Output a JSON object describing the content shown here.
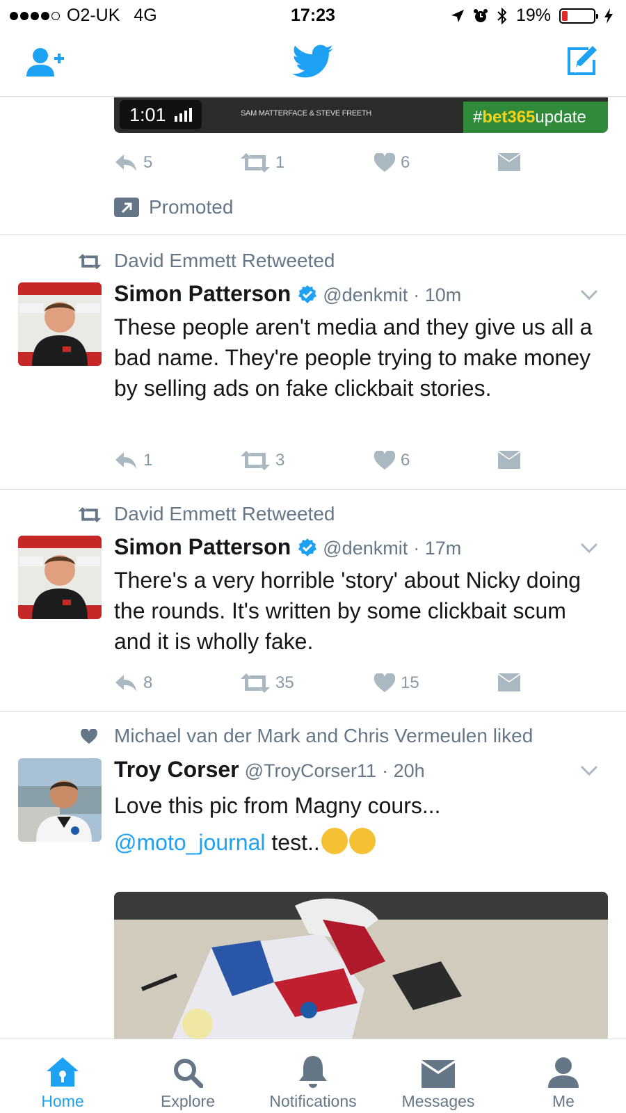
{
  "status_bar": {
    "carrier": "O2-UK",
    "network": "4G",
    "time": "17:23",
    "battery": "19%",
    "battery_level": 0.19,
    "signal_bars": 4
  },
  "nav": {
    "left_icon": "add-user-icon",
    "center_icon": "twitter-bird-icon",
    "right_icon": "compose-icon"
  },
  "colors": {
    "accent": "#1da1f2",
    "secondary_text": "#657786",
    "action_gray": "#8899a6",
    "battery_low": "#e02a2a"
  },
  "promo_tweet": {
    "video_duration": "1:01",
    "video_caption": "SAM MATTERFACE & STEVE FREETH",
    "video_tag_hash": "#",
    "video_tag_bold": "bet365",
    "video_tag_rest": "update",
    "replies": "5",
    "retweets": "1",
    "likes": "6",
    "promoted_label": "Promoted"
  },
  "tweets": [
    {
      "context": "David Emmett Retweeted",
      "name": "Simon Patterson",
      "handle": "@denkmit",
      "time": "· 10m",
      "text": "These people aren't media and they give us all a bad name. They're people trying to make money by selling ads on fake clickbait stories.",
      "replies": "1",
      "retweets": "3",
      "likes": "6"
    },
    {
      "context": "David Emmett Retweeted",
      "name": "Simon Patterson",
      "handle": "@denkmit",
      "time": "· 17m",
      "text": "There's a very horrible 'story' about Nicky doing the rounds. It's written by some clickbait scum  and it is wholly fake.",
      "replies": "8",
      "retweets": "35",
      "likes": "15"
    },
    {
      "context": "Michael van der Mark and Chris Vermeulen liked",
      "name": "Troy Corser",
      "handle": "@TroyCorser11",
      "time": "· 20h",
      "text": "Love this pic from Magny cours...",
      "mention": "@moto_journal",
      "text_after": "test.."
    }
  ],
  "tabs": [
    {
      "label": "Home",
      "icon": "home-icon",
      "active": true
    },
    {
      "label": "Explore",
      "icon": "search-icon"
    },
    {
      "label": "Notifications",
      "icon": "bell-icon"
    },
    {
      "label": "Messages",
      "icon": "envelope-icon"
    },
    {
      "label": "Me",
      "icon": "person-icon"
    }
  ]
}
